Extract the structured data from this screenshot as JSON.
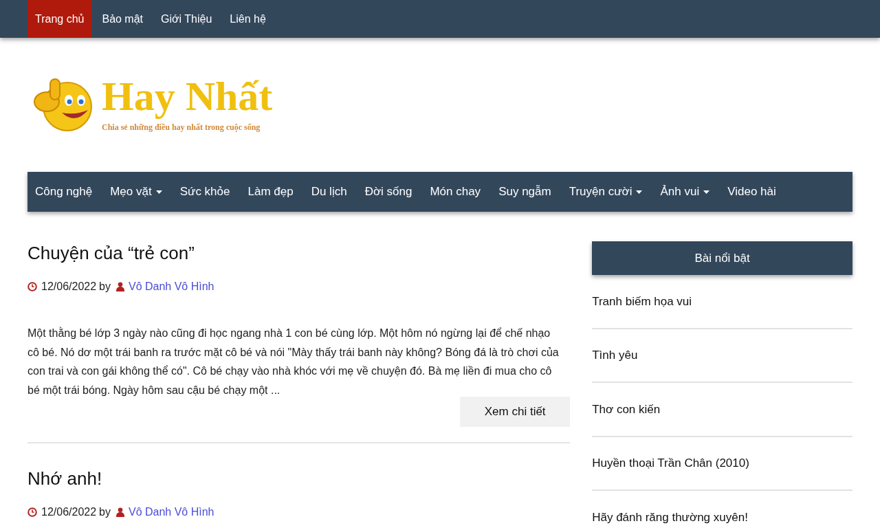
{
  "top_nav": [
    {
      "label": "Trang chủ",
      "selected": true
    },
    {
      "label": "Bảo mật",
      "selected": false
    },
    {
      "label": "Giới Thiệu",
      "selected": false
    },
    {
      "label": "Liên hệ",
      "selected": false
    }
  ],
  "logo": {
    "title": "Hay Nhất",
    "tagline": "Chia sẻ những điều hay nhất trong cuộc sống"
  },
  "main_nav": [
    {
      "label": "Công nghệ",
      "dropdown": false
    },
    {
      "label": "Mẹo vặt",
      "dropdown": true
    },
    {
      "label": "Sức khỏe",
      "dropdown": false
    },
    {
      "label": "Làm đẹp",
      "dropdown": false
    },
    {
      "label": "Du lịch",
      "dropdown": false
    },
    {
      "label": "Đời sống",
      "dropdown": false
    },
    {
      "label": "Món chay",
      "dropdown": false
    },
    {
      "label": "Suy ngẫm",
      "dropdown": false
    },
    {
      "label": "Truyện cười",
      "dropdown": true
    },
    {
      "label": "Ảnh vui",
      "dropdown": true
    },
    {
      "label": "Video hài",
      "dropdown": false
    }
  ],
  "posts": [
    {
      "title": "Chuyện của “trẻ con”",
      "date": "12/06/2022",
      "by": "by",
      "author": "Vô Danh Vô Hình",
      "excerpt": "Một thằng bé lớp 3 ngày nào cũng đi học ngang nhà 1 con bé cùng lớp. Một hôm nó ngừng lại để chế nhạo cô bé. Nó dơ một trái banh ra trước mặt cô bé và nói \"Mày thấy trái banh này không? Bóng đá là trò chơi của con trai và con gái không thể có\". Cô bé chạy vào nhà khóc với mẹ về chuyện đó. Bà mẹ liền đi mua cho cô bé một trái bóng. Ngày hôm sau cậu bé chạy một ...",
      "button": "Xem chi tiết"
    },
    {
      "title": "Nhớ anh!",
      "date": "12/06/2022",
      "by": "by",
      "author": "Vô Danh Vô Hình"
    }
  ],
  "sidebar": {
    "heading": "Bài nổi bật",
    "items": [
      "Tranh biếm họa vui",
      "Tình yêu",
      "Thơ con kiến",
      "Huyền thoại Trần Chân (2010)",
      "Hãy đánh răng thường xuyên!"
    ]
  }
}
